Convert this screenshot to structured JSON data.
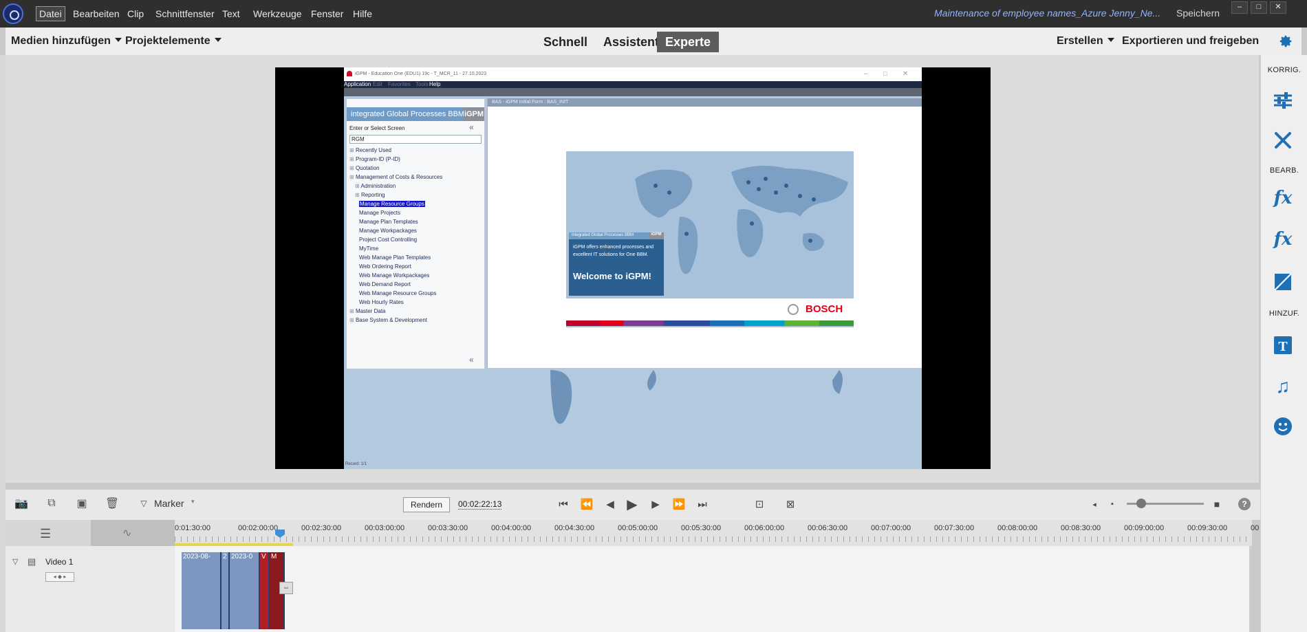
{
  "menu": {
    "items": [
      "Datei",
      "Bearbeiten",
      "Clip",
      "Schnittfenster",
      "Text",
      "Werkzeuge",
      "Fenster",
      "Hilfe"
    ],
    "window_title": "Maintenance of employee names_Azure Jenny_Ne...",
    "save": "Speichern",
    "window_buttons": [
      "–",
      "□",
      "✕"
    ]
  },
  "toolbar": {
    "add_media": "Medien hinzufügen",
    "project_elements": "Projektelemente",
    "modes": [
      "Schnell",
      "Assistent",
      "Experte"
    ],
    "active_mode": "Experte",
    "create": "Erstellen",
    "export": "Exportieren und freigeben"
  },
  "right_panel": {
    "section_adjust": "KORRIG.",
    "section_edit": "BEARB.",
    "section_add": "HINZUF."
  },
  "preview": {
    "app_title": "iGPM - Education One (EDU1) 19c - T_MCR_11 - 27.10.2023",
    "app_menu": [
      "Application",
      "Edit",
      "Favorites",
      "Tools",
      "Help"
    ],
    "sidebar_header": "integrated Global Processes BBM",
    "sidebar_badge": "iGPM",
    "enter_screen": "Enter or Select Screen",
    "search_value": "RGM",
    "tree": [
      {
        "label": "Recently Used",
        "level": 0,
        "selected": false
      },
      {
        "label": "Program-ID (P-ID)",
        "level": 0,
        "selected": false
      },
      {
        "label": "Quotation",
        "level": 0,
        "selected": false
      },
      {
        "label": "Management of Costs & Resources",
        "level": 0,
        "selected": false
      },
      {
        "label": "Administration",
        "level": 1,
        "selected": false
      },
      {
        "label": "Reporting",
        "level": 1,
        "selected": false
      },
      {
        "label": "Manage Resource Groups",
        "level": 2,
        "selected": true
      },
      {
        "label": "Manage Projects",
        "level": 2,
        "selected": false
      },
      {
        "label": "Manage Plan Templates",
        "level": 2,
        "selected": false
      },
      {
        "label": "Manage Workpackages",
        "level": 2,
        "selected": false
      },
      {
        "label": "Project Cost Controlling",
        "level": 2,
        "selected": false
      },
      {
        "label": "MyTime",
        "level": 2,
        "selected": false
      },
      {
        "label": "Web Manage Plan Templates",
        "level": 2,
        "selected": false
      },
      {
        "label": "Web Ordering Report",
        "level": 2,
        "selected": false
      },
      {
        "label": "Web Manage Workpackages",
        "level": 2,
        "selected": false
      },
      {
        "label": "Web Demand Report",
        "level": 2,
        "selected": false
      },
      {
        "label": "Web Manage Resource Groups",
        "level": 2,
        "selected": false
      },
      {
        "label": "Web Hourly Rates",
        "level": 2,
        "selected": false
      },
      {
        "label": "Master Data",
        "level": 0,
        "selected": false
      },
      {
        "label": "Base System & Development",
        "level": 0,
        "selected": false
      }
    ],
    "main_header": "BAS - iGPM Initial Form : BAS_INIT",
    "banner_header": "integrated Global Processes BBM",
    "banner_badge": "iGPM",
    "banner_text": "iGPM offers enhanced processes and excellent IT solutions for One BBM.",
    "welcome": "Welcome to iGPM!",
    "brand": "BOSCH",
    "status": "Record: 1/1"
  },
  "timeline": {
    "marker": "Marker",
    "render": "Rendern",
    "timecode": "00:02:22:13",
    "ticks": [
      "0:01:30:00",
      "00:02:00:00",
      "00:02:30:00",
      "00:03:00:00",
      "00:03:30:00",
      "00:04:00:00",
      "00:04:30:00",
      "00:05:00:00",
      "00:05:30:00",
      "00:06:00:00",
      "00:06:30:00",
      "00:07:00:00",
      "00:07:30:00",
      "00:08:00:00",
      "00:08:30:00",
      "00:09:00:00",
      "00:09:30:00",
      "00"
    ],
    "track_name": "Video 1",
    "clips": [
      "2023-08-",
      "2",
      "2023-0",
      "V",
      "M"
    ],
    "help": "?"
  }
}
